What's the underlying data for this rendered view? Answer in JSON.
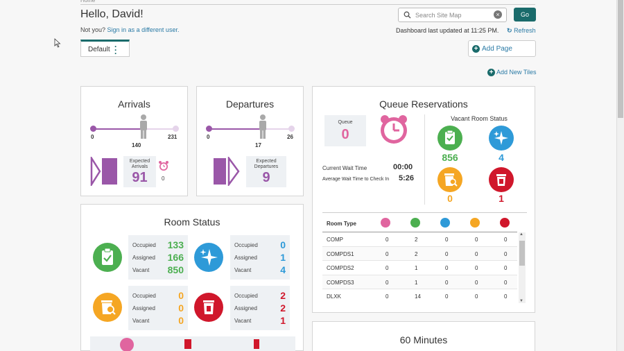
{
  "header": {
    "greeting": "Hello, David!",
    "not_you": "Not you?",
    "sign_in_link": "Sign in as a different user.",
    "search_placeholder": "Search Site Map",
    "go_label": "Go",
    "updated_text": "Dashboard last updated at 11:25 PM.",
    "refresh_label": "Refresh",
    "tab_label": "Default",
    "add_page_label": "Add Page",
    "add_tiles_label": "Add New Tiles"
  },
  "arrivals": {
    "title": "Arrivals",
    "min": "0",
    "current": "140",
    "max": "231",
    "progress_fraction": 0.606,
    "expected_label_1": "Expected",
    "expected_label_2": "Arrivals",
    "expected_value": "91",
    "alarm_value": "0"
  },
  "departures": {
    "title": "Departures",
    "min": "0",
    "current": "17",
    "max": "26",
    "progress_fraction": 0.654,
    "expected_label_1": "Expected",
    "expected_label_2": "Departures",
    "expected_value": "9"
  },
  "queue": {
    "title": "Queue Reservations",
    "queue_label": "Queue",
    "queue_value": "0",
    "vacant_title": "Vacant Room Status",
    "vacant_values": [
      "856",
      "4",
      "0",
      "1"
    ],
    "current_wait_label": "Current Wait Time",
    "current_wait_value": "00:00",
    "avg_wait_label": "Average Wait Time to Check In",
    "avg_wait_value": "5:26",
    "table_header": "Room Type",
    "rows": [
      {
        "type": "COMP",
        "c1": "0",
        "c2": "2",
        "c3": "0",
        "c4": "0",
        "c5": "0"
      },
      {
        "type": "COMPDS1",
        "c1": "0",
        "c2": "2",
        "c3": "0",
        "c4": "0",
        "c5": "0"
      },
      {
        "type": "COMPDS2",
        "c1": "0",
        "c2": "1",
        "c3": "0",
        "c4": "0",
        "c5": "0"
      },
      {
        "type": "COMPDS3",
        "c1": "0",
        "c2": "1",
        "c3": "0",
        "c4": "0",
        "c5": "0"
      },
      {
        "type": "DLXK",
        "c1": "0",
        "c2": "14",
        "c3": "0",
        "c4": "0",
        "c5": "0"
      }
    ]
  },
  "room_status": {
    "title": "Room Status",
    "occupied_label": "Occupied",
    "assigned_label": "Assigned",
    "vacant_label": "Vacant",
    "clean": {
      "occupied": "133",
      "assigned": "166",
      "vacant": "850"
    },
    "inspected": {
      "occupied": "0",
      "assigned": "1",
      "vacant": "4"
    },
    "pickup": {
      "occupied": "0",
      "assigned": "0",
      "vacant": "0"
    },
    "dirty": {
      "occupied": "2",
      "assigned": "2",
      "vacant": "1"
    }
  },
  "sixty": {
    "title": "60 Minutes"
  },
  "colors": {
    "teal": "#1a6b6b",
    "purple": "#9a57a8",
    "green": "#4caf50",
    "blue": "#2e9ad8",
    "orange": "#f5a623",
    "red": "#d0172b",
    "pink": "#e0659f"
  }
}
